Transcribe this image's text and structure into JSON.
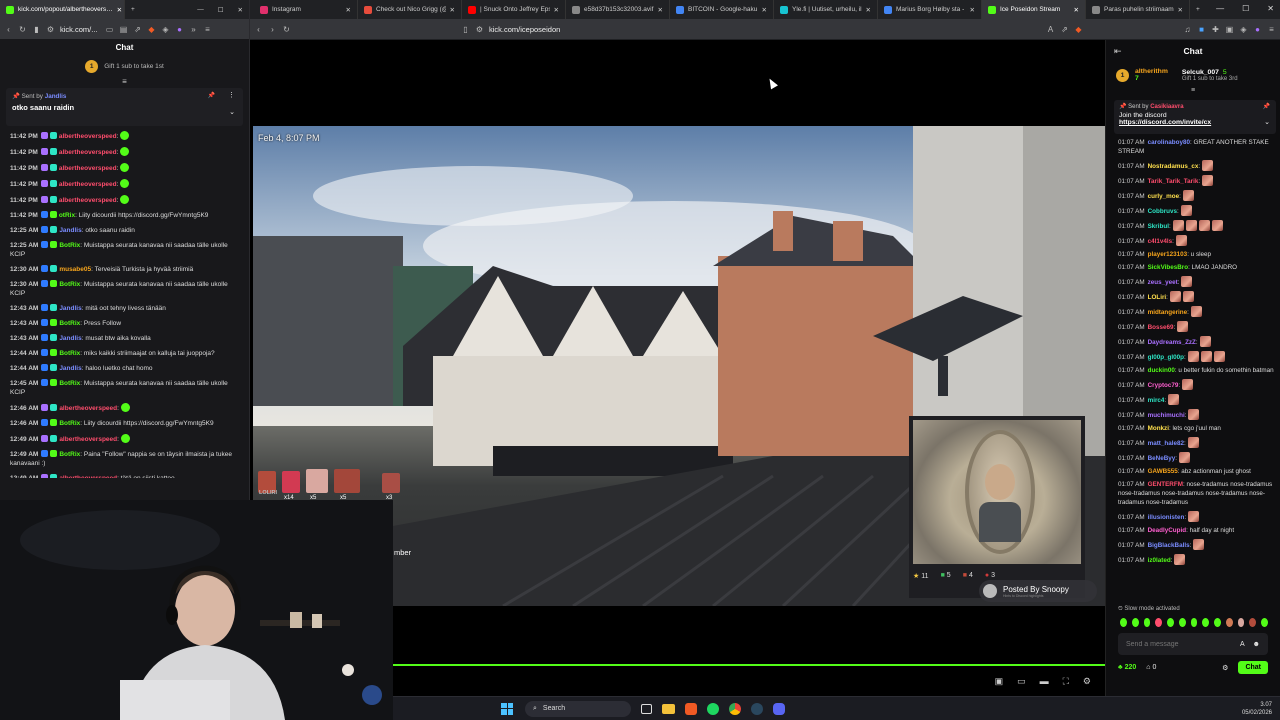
{
  "top_browser": {
    "tabs": [
      {
        "label": "Instagram",
        "color": "#e1306c"
      },
      {
        "label": "Check out Nico Grigg (@nico",
        "color": "#e74c3c"
      },
      {
        "label": "| Snuck Onto Jeffrey Epstein",
        "color": "#ff0000"
      },
      {
        "label": "e58d37b153c32003.avif (161…",
        "color": "#888888"
      },
      {
        "label": "BITCOIN - Google-haku",
        "color": "#4285f4"
      },
      {
        "label": "Yle.fi | Uutiset, urheilu, ilmiöt",
        "color": "#17c3d1"
      },
      {
        "label": "Marius Borg Høiby sta - Goo",
        "color": "#4285f4"
      },
      {
        "label": "Ice Poseidon Stream",
        "color": "#53fc18"
      },
      {
        "label": "Paras puhelin striimaamiseen",
        "color": "#888888"
      }
    ],
    "url": "kick.com/iceposeidon",
    "new_tab": "+"
  },
  "left_window": {
    "tab_label": "kick.com/popout/albertheovers…",
    "url": "kick.com/...",
    "chat_title": "Chat",
    "gift_text": "Gift 1 sub to take 1st",
    "gift_rank": "1",
    "pinned": {
      "sent_by_label": "Sent by",
      "user": "Jandlis",
      "text": "otko saanu raidin"
    },
    "messages": [
      {
        "time": "11:42 PM",
        "user": "albertheoverspeed",
        "cls": "u-red",
        "text": ":",
        "emote": true
      },
      {
        "time": "11:42 PM",
        "user": "albertheoverspeed",
        "cls": "u-red",
        "text": ":",
        "emote": true
      },
      {
        "time": "11:42 PM",
        "user": "albertheoverspeed",
        "cls": "u-red",
        "text": ":",
        "emote": true
      },
      {
        "time": "11:42 PM",
        "user": "albertheoverspeed",
        "cls": "u-red",
        "text": ":",
        "emote": true
      },
      {
        "time": "11:42 PM",
        "user": "albertheoverspeed",
        "cls": "u-red",
        "text": ":",
        "emote": true
      },
      {
        "time": "11:42 PM",
        "user": "otRix",
        "cls": "u-green",
        "text": ": Liity dicourdii https://discord.gg/FwYmntg5K9",
        "emote": false
      },
      {
        "time": "12:25 AM",
        "user": "Jandlis",
        "cls": "u-blue",
        "text": ": otko saanu raidin",
        "emote": false
      },
      {
        "time": "12:25 AM",
        "user": "BotRix",
        "cls": "u-green",
        "text": ": Muistappa seurata kanavaa nii saadaa tälle ukolle KCIP",
        "emote": false
      },
      {
        "time": "12:30 AM",
        "user": "musabe05",
        "cls": "u-orange",
        "text": ": Terveisiä Turkista ja hyvää striimiä",
        "emote": false
      },
      {
        "time": "12:30 AM",
        "user": "BotRix",
        "cls": "u-green",
        "text": ": Muistappa seurata kanavaa nii saadaa tälle ukolle KCIP",
        "emote": false
      },
      {
        "time": "12:43 AM",
        "user": "Jandlis",
        "cls": "u-blue",
        "text": ": mitä oot tehny livess tänään",
        "emote": false
      },
      {
        "time": "12:43 AM",
        "user": "BotRix",
        "cls": "u-green",
        "text": ": Press Follow",
        "emote": false
      },
      {
        "time": "12:43 AM",
        "user": "Jandlis",
        "cls": "u-blue",
        "text": ": musat btw aika kovalla",
        "emote": false
      },
      {
        "time": "12:44 AM",
        "user": "BotRix",
        "cls": "u-green",
        "text": ": miks kaikki striimaajat on kalluja tai juoppoja?",
        "emote": false
      },
      {
        "time": "12:44 AM",
        "user": "Jandlis",
        "cls": "u-blue",
        "text": ": haloo luetko chat homo",
        "emote": false
      },
      {
        "time": "12:45 AM",
        "user": "BotRix",
        "cls": "u-green",
        "text": ": Muistappa seurata kanavaa nii saadaa tälle ukolle KCIP",
        "emote": false
      },
      {
        "time": "12:46 AM",
        "user": "albertheoverspeed",
        "cls": "u-red",
        "text": ":",
        "emote": true
      },
      {
        "time": "12:46 AM",
        "user": "BotRix",
        "cls": "u-green",
        "text": ": Liity dicourdii https://discord.gg/FwYmntg5K9",
        "emote": false
      },
      {
        "time": "12:49 AM",
        "user": "albertheoverspeed",
        "cls": "u-red",
        "text": ":",
        "emote": true
      },
      {
        "time": "12:49 AM",
        "user": "BotRix",
        "cls": "u-green",
        "text": ": Paina \"Follow\" nappia se on täysin ilmaista ja tukee kanavaani :)",
        "emote": false
      },
      {
        "time": "12:49 AM",
        "user": "albertheoverspeed",
        "cls": "u-red",
        "text": ": tätä on siisti kattoo",
        "emote": false
      }
    ]
  },
  "stream": {
    "timestamp": "Feb 4, 8:07 PM",
    "caption_fragment": "mber",
    "posted_by": "Posted By Snoopy",
    "posted_sub": "Hints to Discord highlights",
    "stats": [
      {
        "icon": "star-icon",
        "value": "11"
      },
      {
        "icon": "green-box-icon",
        "value": "5"
      },
      {
        "icon": "red-box-icon",
        "value": "4"
      },
      {
        "icon": "ring-icon",
        "value": "3"
      }
    ],
    "gift_counts": [
      "x14",
      "x5",
      "x5",
      "x3"
    ],
    "overlay_label": "LOLIRI"
  },
  "right_chat": {
    "title": "Chat",
    "leaders": [
      {
        "rank": "1",
        "user": "altherithm",
        "count": "7"
      },
      {
        "rank": "",
        "user": "Selcuk_007",
        "count": "5",
        "sub": "Gift 1 sub to take 3rd"
      }
    ],
    "pinned": {
      "sent_by_label": "Sent by",
      "user": "Casikiaavra",
      "line1": "Join the discord",
      "line2": "https://discord.com/invite/cx"
    },
    "messages": [
      {
        "time": "01:07 AM",
        "user": "carolinaboy80",
        "cls": "u-blue",
        "text": ": GREAT ANOTHER STAKE STREAM"
      },
      {
        "time": "01:07 AM",
        "user": "Nostradamus_cx",
        "cls": "u-yellow",
        "text": ":",
        "faces": 1
      },
      {
        "time": "01:07 AM",
        "user": "Tarik_Tarik_Tarik",
        "cls": "u-red",
        "text": ":",
        "faces": 1
      },
      {
        "time": "01:07 AM",
        "user": "curly_moe",
        "cls": "u-yellow",
        "text": ":",
        "faces": 1
      },
      {
        "time": "01:07 AM",
        "user": "Cobbruvs",
        "cls": "u-teal",
        "text": ":",
        "faces": 1
      },
      {
        "time": "01:07 AM",
        "user": "Skribul",
        "cls": "u-teal",
        "text": ":",
        "faces": 4
      },
      {
        "time": "01:07 AM",
        "user": "c4l1v4ls",
        "cls": "u-red",
        "text": ":",
        "faces": 1
      },
      {
        "time": "01:07 AM",
        "user": "player123103",
        "cls": "u-orange",
        "text": ": u sleep"
      },
      {
        "time": "01:07 AM",
        "user": "SickVibesBro",
        "cls": "u-green",
        "text": ": LMAO JANDRO"
      },
      {
        "time": "01:07 AM",
        "user": "zeus_yeet",
        "cls": "u-purple",
        "text": ":",
        "faces": 1
      },
      {
        "time": "01:07 AM",
        "user": "LOLiri",
        "cls": "u-yellow",
        "text": ":",
        "faces": 2
      },
      {
        "time": "01:07 AM",
        "user": "midtangerine",
        "cls": "u-orange",
        "text": ":",
        "faces": 1
      },
      {
        "time": "01:07 AM",
        "user": "Bosse69",
        "cls": "u-red",
        "text": ":",
        "faces": 1
      },
      {
        "time": "01:07 AM",
        "user": "Daydreams_ZzZ",
        "cls": "u-purple",
        "text": ":",
        "faces": 1
      },
      {
        "time": "01:07 AM",
        "user": "gl00p_gl00p",
        "cls": "u-teal",
        "text": ":",
        "faces": 3
      },
      {
        "time": "01:07 AM",
        "user": "duckin00",
        "cls": "u-green",
        "text": ": u better fukin do somethin batman"
      },
      {
        "time": "01:07 AM",
        "user": "Cryptoc79",
        "cls": "u-pink",
        "text": ":",
        "faces": 1
      },
      {
        "time": "01:07 AM",
        "user": "mirc4",
        "cls": "u-teal",
        "text": ":",
        "faces": 1
      },
      {
        "time": "01:07 AM",
        "user": "muchimuchi",
        "cls": "u-purple",
        "text": ":",
        "faces": 1
      },
      {
        "time": "01:07 AM",
        "user": "Monkzi",
        "cls": "u-yellow",
        "text": ": lets cgo j'uul man"
      },
      {
        "time": "01:07 AM",
        "user": "matt_hale82",
        "cls": "u-blue",
        "text": ":",
        "faces": 1
      },
      {
        "time": "01:07 AM",
        "user": "BeNeByy",
        "cls": "u-blue",
        "text": ":",
        "faces": 1
      },
      {
        "time": "01:07 AM",
        "user": "GAWB555",
        "cls": "u-orange",
        "text": ": abz actionman just ghost"
      },
      {
        "time": "01:07 AM",
        "user": "GENTERFM",
        "cls": "u-red",
        "text": ": nose-tradamus nose-tradamus nose-tradamus nose-tradamus nose-tradamus nose-tradamus nose-tradamus"
      },
      {
        "time": "01:07 AM",
        "user": "illusionisten",
        "cls": "u-blue",
        "text": ":",
        "faces": 1
      },
      {
        "time": "01:07 AM",
        "user": "DeadlyCupid",
        "cls": "u-pink",
        "text": ": half day at night"
      },
      {
        "time": "01:07 AM",
        "user": "BigBlackBalls",
        "cls": "u-blue",
        "text": ":",
        "faces": 1
      },
      {
        "time": "01:07 AM",
        "user": "iz0lated",
        "cls": "u-green",
        "text": ":",
        "faces": 1
      }
    ],
    "slow_mode": "Slow mode activated",
    "input_placeholder": "Send a message",
    "viewers": "220",
    "gift_count": "0",
    "chat_button": "Chat"
  },
  "taskbar": {
    "search_label": "Search",
    "time": "3.07",
    "date": "05/02/2026"
  },
  "colors": {
    "kick_green": "#53fc18",
    "chat_bg": "#0e0e10"
  }
}
